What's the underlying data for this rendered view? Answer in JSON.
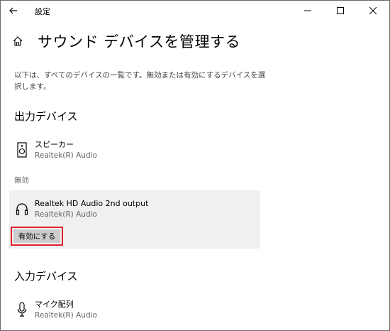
{
  "window": {
    "title": "設定",
    "controls": {
      "minimize": "minimize-icon",
      "maximize": "maximize-icon",
      "close": "close-icon"
    }
  },
  "header": {
    "title": "サウンド デバイスを管理する",
    "icon": "home-icon"
  },
  "description": "以下は、すべてのデバイスの一覧です。無効または有効にするデバイスを選択します。",
  "output": {
    "heading": "出力デバイス",
    "devices": [
      {
        "name": "スピーカー",
        "driver": "Realtek(R) Audio",
        "icon": "speaker-icon"
      }
    ],
    "disabled_label": "無効",
    "disabled_devices": [
      {
        "name": "Realtek HD Audio 2nd output",
        "driver": "Realtek(R) Audio",
        "icon": "headphones-icon",
        "action_label": "有効にする"
      }
    ]
  },
  "input": {
    "heading": "入力デバイス",
    "devices": [
      {
        "name": "マイク配列",
        "driver": "Realtek(R) Audio",
        "icon": "microphone-icon"
      }
    ]
  },
  "colors": {
    "highlight_border": "#e0202a",
    "card_bg": "#f0f0f0",
    "button_bg": "#cccccc"
  }
}
